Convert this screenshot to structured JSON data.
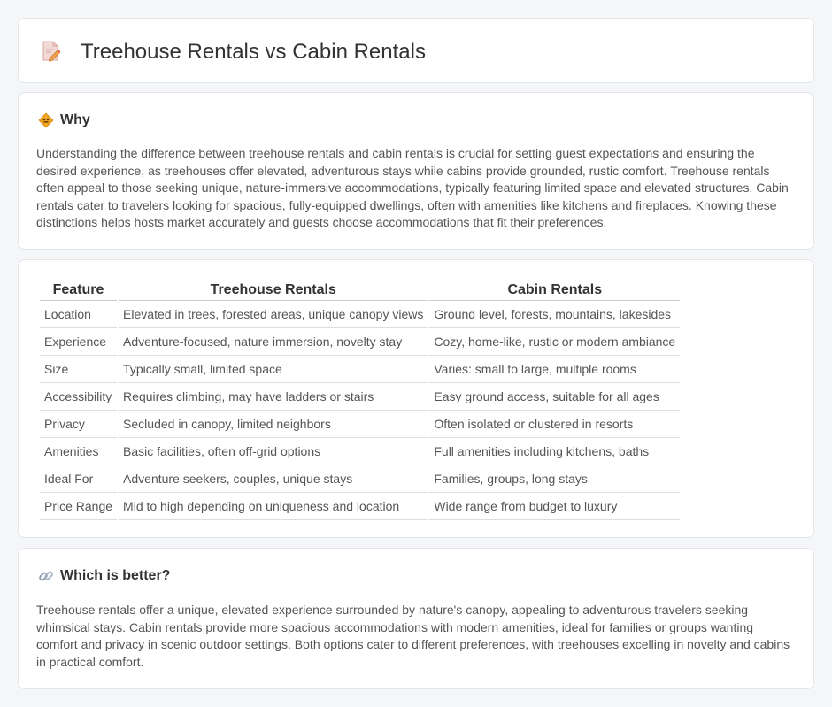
{
  "header": {
    "title": "Treehouse Rentals vs Cabin Rentals",
    "icon": "document-pencil-icon"
  },
  "why": {
    "icon": "diamond-sign-icon",
    "title": "Why",
    "text": "Understanding the difference between treehouse rentals and cabin rentals is crucial for setting guest expectations and ensuring the desired experience, as treehouses offer elevated, adventurous stays while cabins provide grounded, rustic comfort. Treehouse rentals often appeal to those seeking unique, nature-immersive accommodations, typically featuring limited space and elevated structures. Cabin rentals cater to travelers looking for spacious, fully-equipped dwellings, often with amenities like kitchens and fireplaces. Knowing these distinctions helps hosts market accurately and guests choose accommodations that fit their preferences."
  },
  "table": {
    "headers": [
      "Feature",
      "Treehouse Rentals",
      "Cabin Rentals"
    ],
    "rows": [
      [
        "Location",
        "Elevated in trees, forested areas, unique canopy views",
        "Ground level, forests, mountains, lakesides"
      ],
      [
        "Experience",
        "Adventure-focused, nature immersion, novelty stay",
        "Cozy, home-like, rustic or modern ambiance"
      ],
      [
        "Size",
        "Typically small, limited space",
        "Varies: small to large, multiple rooms"
      ],
      [
        "Accessibility",
        "Requires climbing, may have ladders or stairs",
        "Easy ground access, suitable for all ages"
      ],
      [
        "Privacy",
        "Secluded in canopy, limited neighbors",
        "Often isolated or clustered in resorts"
      ],
      [
        "Amenities",
        "Basic facilities, often off-grid options",
        "Full amenities including kitchens, baths"
      ],
      [
        "Ideal For",
        "Adventure seekers, couples, unique stays",
        "Families, groups, long stays"
      ],
      [
        "Price Range",
        "Mid to high depending on uniqueness and location",
        "Wide range from budget to luxury"
      ]
    ]
  },
  "better": {
    "icon": "link-icon",
    "title": "Which is better?",
    "text": "Treehouse rentals offer a unique, elevated experience surrounded by nature's canopy, appealing to adventurous travelers seeking whimsical stays. Cabin rentals provide more spacious accommodations with modern amenities, ideal for families or groups wanting comfort and privacy in scenic outdoor settings. Both options cater to different preferences, with treehouses excelling in novelty and cabins in practical comfort."
  }
}
